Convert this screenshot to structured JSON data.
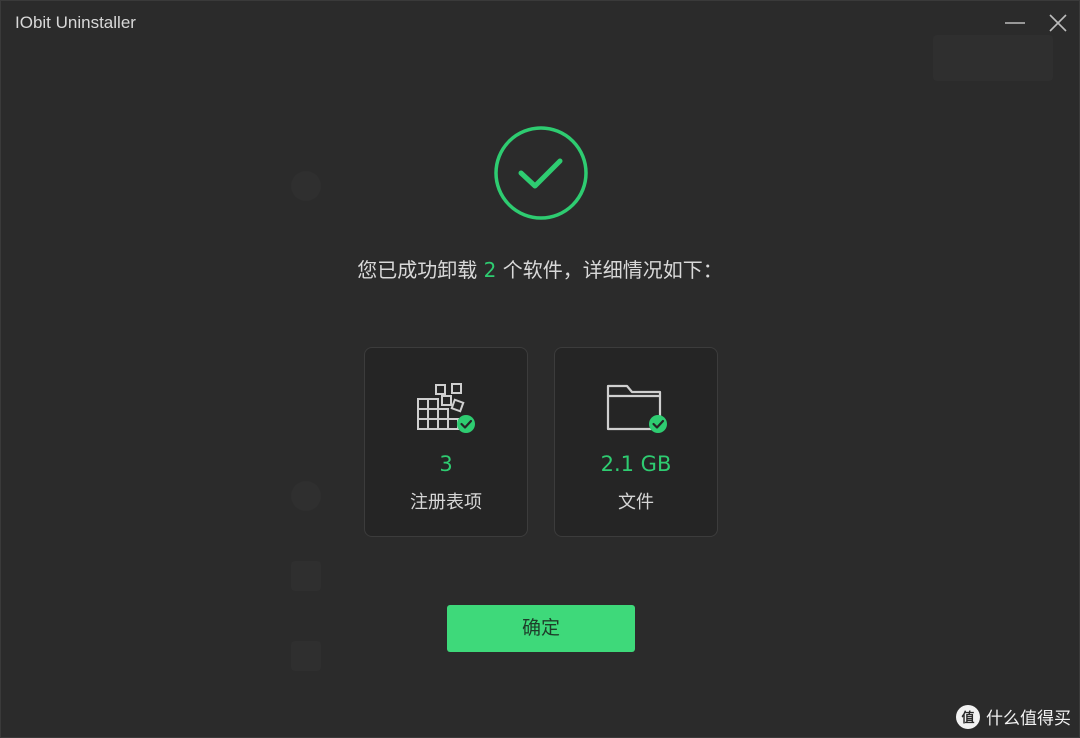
{
  "window": {
    "title": "IObit Uninstaller"
  },
  "result": {
    "message_prefix": "您已成功卸载 ",
    "count": "2",
    "message_suffix": " 个软件，详细情况如下："
  },
  "cards": [
    {
      "value": "3",
      "label": "注册表项",
      "icon": "registry-icon"
    },
    {
      "value": "2.1 GB",
      "label": "文件",
      "icon": "folder-icon"
    }
  ],
  "confirm": {
    "label": "确定"
  },
  "watermark": {
    "badge": "值",
    "text": "什么值得买"
  },
  "colors": {
    "accent": "#2ecc71",
    "button": "#3ed97a",
    "background": "#2b2b2b",
    "card": "#252525"
  }
}
